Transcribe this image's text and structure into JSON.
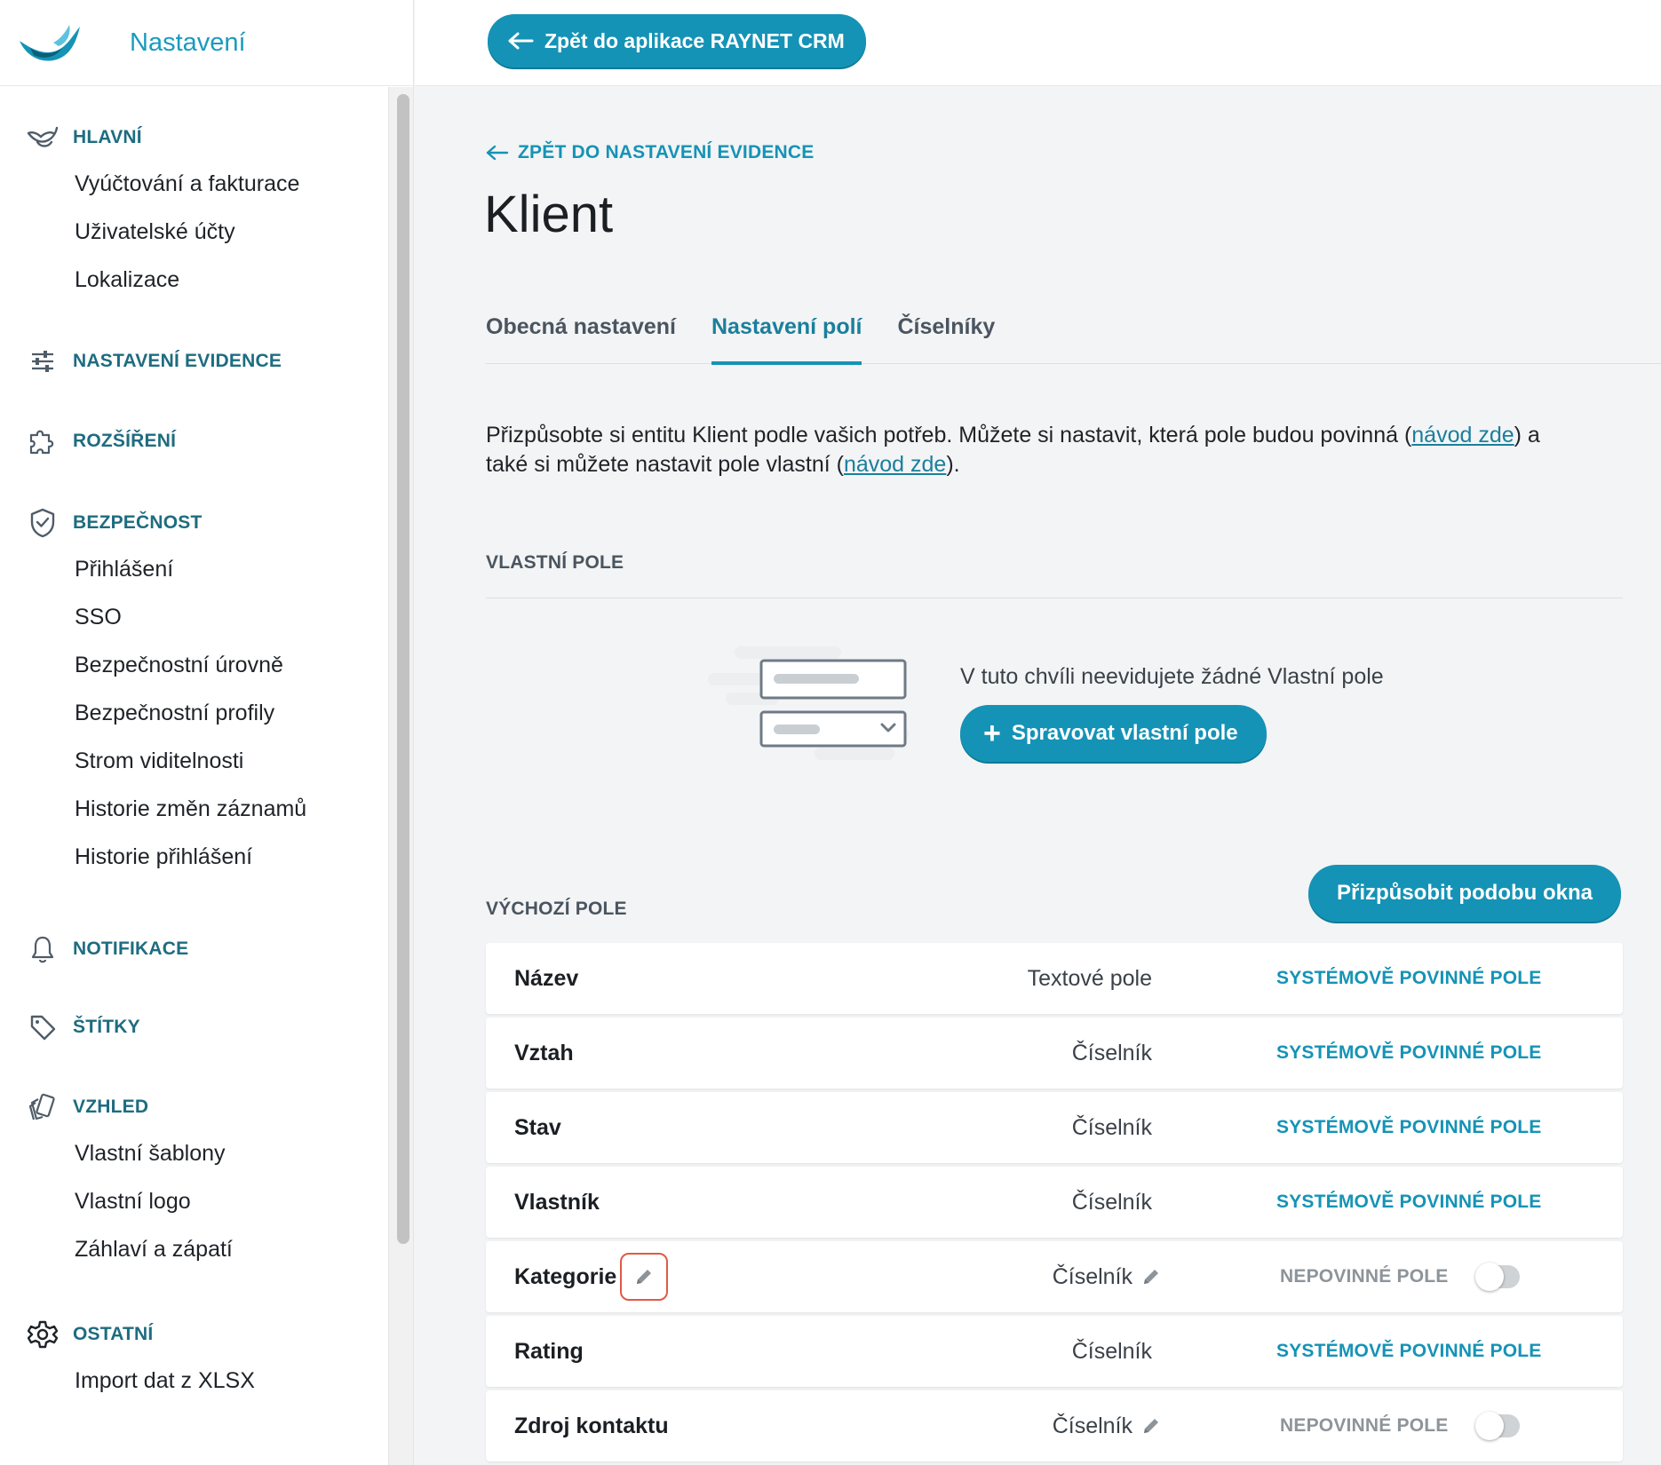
{
  "app": {
    "title": "Nastavení"
  },
  "topbar": {
    "back_label": "Zpět do aplikace RAYNET CRM"
  },
  "sidebar": {
    "sections": [
      {
        "key": "hlavni",
        "label": "HLAVNÍ",
        "icon": "bird-icon",
        "items": [
          "Vyúčtování a fakturace",
          "Uživatelské účty",
          "Lokalizace"
        ]
      },
      {
        "key": "evidence",
        "label": "NASTAVENÍ EVIDENCE",
        "icon": "sliders-icon",
        "items": []
      },
      {
        "key": "rozsireni",
        "label": "ROZŠÍŘENÍ",
        "icon": "puzzle-icon",
        "items": []
      },
      {
        "key": "bezpecnost",
        "label": "BEZPEČNOST",
        "icon": "shield-check-icon",
        "items": [
          "Přihlášení",
          "SSO",
          "Bezpečnostní úrovně",
          "Bezpečnostní profily",
          "Strom viditelnosti",
          "Historie změn záznamů",
          "Historie přihlášení"
        ]
      },
      {
        "key": "notifikace",
        "label": "NOTIFIKACE",
        "icon": "bell-icon",
        "items": []
      },
      {
        "key": "stitky",
        "label": "ŠTÍTKY",
        "icon": "tag-icon",
        "items": []
      },
      {
        "key": "vzhled",
        "label": "VZHLED",
        "icon": "cards-icon",
        "items": [
          "Vlastní šablony",
          "Vlastní logo",
          "Záhlaví a zápatí"
        ]
      },
      {
        "key": "ostatni",
        "label": "OSTATNÍ",
        "icon": "gear-icon",
        "items": [
          "Import dat z XLSX"
        ]
      }
    ]
  },
  "main": {
    "back_link": "ZPĚT DO NASTAVENÍ EVIDENCE",
    "title": "Klient",
    "tabs": [
      {
        "label": "Obecná nastavení",
        "active": false
      },
      {
        "label": "Nastavení polí",
        "active": true
      },
      {
        "label": "Číselníky",
        "active": false
      }
    ],
    "intro": {
      "part1": "Přizpůsobte si entitu Klient podle vašich potřeb. Můžete si nastavit, která pole budou povinná (",
      "link1": "návod zde",
      "part2": ") a také si můžete nastavit pole vlastní (",
      "link2": "návod zde",
      "part3": ")."
    },
    "custom_fields": {
      "label": "VLASTNÍ POLE",
      "empty_text": "V tuto chvíli neevidujete žádné Vlastní pole",
      "manage_label": "Spravovat vlastní pole"
    },
    "default_fields": {
      "label": "VÝCHOZÍ POLE",
      "customize_label": "Přizpůsobit podobu okna",
      "rows": [
        {
          "name": "Název",
          "type": "Textové pole",
          "status": "SYSTÉMOVĚ POVINNÉ POLE",
          "optional": false,
          "type_editable": false,
          "name_editable": false
        },
        {
          "name": "Vztah",
          "type": "Číselník",
          "status": "SYSTÉMOVĚ POVINNÉ POLE",
          "optional": false,
          "type_editable": false,
          "name_editable": false
        },
        {
          "name": "Stav",
          "type": "Číselník",
          "status": "SYSTÉMOVĚ POVINNÉ POLE",
          "optional": false,
          "type_editable": false,
          "name_editable": false
        },
        {
          "name": "Vlastník",
          "type": "Číselník",
          "status": "SYSTÉMOVĚ POVINNÉ POLE",
          "optional": false,
          "type_editable": false,
          "name_editable": false
        },
        {
          "name": "Kategorie",
          "type": "Číselník",
          "status": "NEPOVINNÉ POLE",
          "optional": true,
          "type_editable": true,
          "name_editable": true
        },
        {
          "name": "Rating",
          "type": "Číselník",
          "status": "SYSTÉMOVĚ POVINNÉ POLE",
          "optional": false,
          "type_editable": false,
          "name_editable": false
        },
        {
          "name": "Zdroj kontaktu",
          "type": "Číselník",
          "status": "NEPOVINNÉ POLE",
          "optional": true,
          "type_editable": true,
          "name_editable": false
        }
      ]
    }
  },
  "colors": {
    "accent": "#1593b6",
    "sidebar_heading": "#1e6c80",
    "highlight": "#e05a46"
  }
}
